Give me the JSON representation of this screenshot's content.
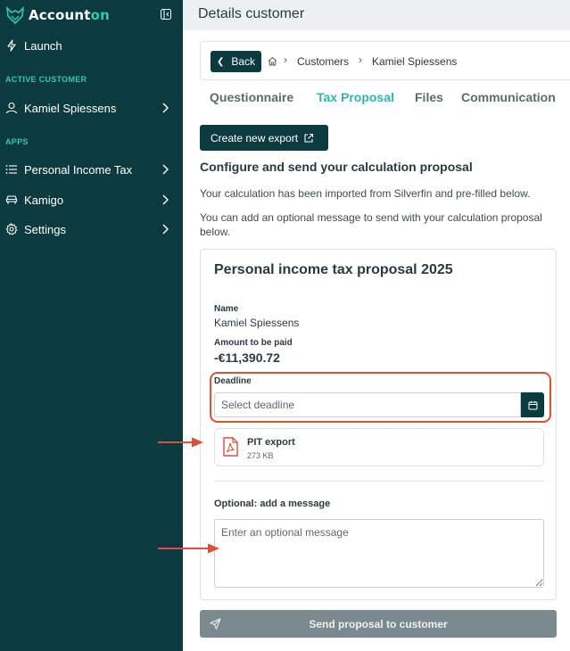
{
  "app": {
    "brand_main": "Account",
    "brand_accent": "on",
    "brand_color": "#2fc9ad",
    "sidebar_color": "#0c3b3f"
  },
  "sidebar": {
    "launch": {
      "label": "Launch",
      "icon": "bolt-icon"
    },
    "active_customer_heading": "ACTIVE CUSTOMER",
    "customer": {
      "label": "Kamiel Spiessens",
      "icon": "user-icon"
    },
    "apps_heading": "APPS",
    "items": [
      {
        "label": "Personal Income Tax",
        "icon": "list-icon"
      },
      {
        "label": "Kamigo",
        "icon": "car-icon"
      },
      {
        "label": "Settings",
        "icon": "gear-icon"
      }
    ]
  },
  "header": {
    "title": "Details customer"
  },
  "breadcrumb": {
    "back_label": "Back",
    "crumbs": [
      "Customers",
      "Kamiel Spiessens"
    ]
  },
  "tabs": [
    {
      "label": "Questionnaire",
      "active": false
    },
    {
      "label": "Tax Proposal",
      "active": true
    },
    {
      "label": "Files",
      "active": false
    },
    {
      "label": "Communication",
      "active": false
    }
  ],
  "main": {
    "export_button": "Create new export",
    "section_title": "Configure and send your calculation proposal",
    "desc_1": "Your calculation has been imported from Silverfin and pre-filled below.",
    "desc_2": "You can add an optional message to send with your calculation proposal below."
  },
  "card": {
    "title": "Personal income tax proposal 2025",
    "name_label": "Name",
    "name_value": "Kamiel Spiessens",
    "amount_label": "Amount to be paid",
    "amount_value": "-€11,390.72",
    "deadline_label": "Deadline",
    "deadline_placeholder": "Select deadline",
    "file": {
      "name": "PIT export",
      "size": "273 KB",
      "icon": "pdf-icon"
    },
    "message_label": "Optional: add a message",
    "message_placeholder": "Enter an optional message"
  },
  "send_button": "Send proposal to customer",
  "annotation_color": "#d9503b"
}
